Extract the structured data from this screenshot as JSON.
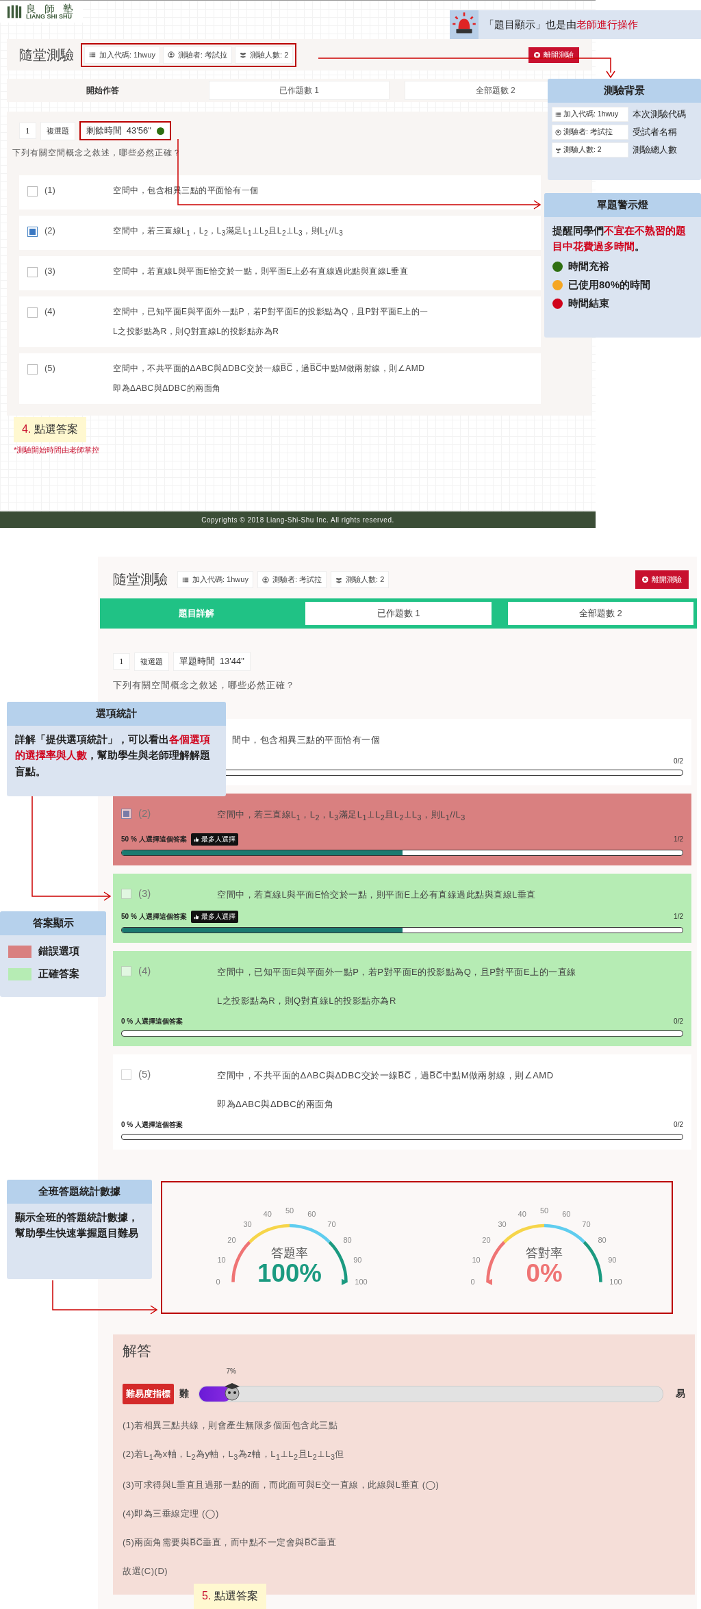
{
  "top_screen": {
    "logo": {
      "name": "良 師 塾",
      "subtitle": "LIANG SHI SHU"
    },
    "header": {
      "title": "隨堂測驗",
      "chips": [
        {
          "kind": "code",
          "text": "加入代碼: 1hwuy"
        },
        {
          "kind": "tester",
          "text": "測驗者: 考試拉"
        },
        {
          "kind": "count",
          "text": "測驗人數: 2"
        }
      ],
      "leave_button": "離開測驗"
    },
    "tabs": [
      {
        "label": "開始作答",
        "selected": true
      },
      {
        "label": "已作題數 1",
        "selected": false
      },
      {
        "label": "全部題數 2",
        "selected": false
      }
    ],
    "question": {
      "number": "1",
      "type": "複選題",
      "timer": {
        "label": "剩餘時間",
        "value": "43'56\"",
        "color": "#2f6f12"
      },
      "prompt": "下列有關空間概念之敘述，哪些必然正確？",
      "options": [
        {
          "label": "(1)",
          "checked": false,
          "lines": [
            "空間中，包含相異三點的平面恰有一個"
          ]
        },
        {
          "label": "(2)",
          "checked": true,
          "lines": [
            "空間中，若三直線L$_{1}$，L$_{2}$，L$_{3}$滿足L$_{1}$⊥L$_{2}$且L$_{2}$⊥L$_{3}$，則L$_{1}$//L$_{3}$"
          ]
        },
        {
          "label": "(3)",
          "checked": false,
          "lines": [
            "空間中，若直線L與平面E恰交於一點，則平面E上必有直線過此點與直線L垂直"
          ]
        },
        {
          "label": "(4)",
          "checked": false,
          "lines": [
            "空間中，已知平面E與平面外一點P，若P對平面E的投影點為Q，且P對平面E上的一",
            "L之投影點為R，則Q對直線L的投影點亦為R"
          ]
        },
        {
          "label": "(5)",
          "checked": false,
          "lines": [
            "空間中，不共平面的ΔABC與ΔDBC交於一線B̅C̅，過B̅C̅中點M做兩射線，則∠AMD",
            "即為ΔABC與ΔDBC的兩面角"
          ]
        }
      ]
    },
    "note": {
      "step": "4.",
      "text": "點選答案"
    },
    "footnote": "*測驗開始時間由老師掌控",
    "footer": "Copyrights © 2018 Liang-Shi-Shu Inc. All rights reserved."
  },
  "top_callouts": {
    "banner": {
      "parts": [
        {
          "text": "「題目顯示」也是由",
          "emphasis": false
        },
        {
          "text": "老師進行操作",
          "emphasis": true
        }
      ]
    },
    "background": {
      "title": "測驗背景",
      "rows": [
        {
          "kind": "code",
          "chip": "加入代碼: 1hwuy",
          "label": "本次測驗代碼"
        },
        {
          "kind": "tester",
          "chip": "測驗者: 考試拉",
          "label": "受試者名稱"
        },
        {
          "kind": "count",
          "chip": "測驗人數: 2",
          "label": "測驗總人數"
        }
      ]
    },
    "warning": {
      "title": "單題警示燈",
      "parts": [
        {
          "text": "提醒同學們",
          "emphasis": false
        },
        {
          "text": "不宜在不熟習的題目中花費過多時間",
          "emphasis": true
        },
        {
          "text": "。",
          "emphasis": false
        }
      ],
      "items": [
        {
          "color": "#2f6f12",
          "label": "時間充裕"
        },
        {
          "color": "#f5a623",
          "label": "已使用80%的時間"
        },
        {
          "color": "#d0021b",
          "label": "時間結束"
        }
      ]
    }
  },
  "bottom_screen": {
    "header": {
      "title": "隨堂測驗",
      "chips": [
        {
          "kind": "code",
          "text": "加入代碼: 1hwuy"
        },
        {
          "kind": "tester",
          "text": "測驗者: 考試拉"
        },
        {
          "kind": "count",
          "text": "測驗人數: 2"
        }
      ],
      "leave_button": "離開測驗"
    },
    "tabs": [
      {
        "label": "題目詳解",
        "selected": true
      },
      {
        "label": "已作題數 1",
        "selected": false
      },
      {
        "label": "全部題數 2",
        "selected": false
      }
    ],
    "question": {
      "number": "1",
      "type": "複選題",
      "timer_label": "單題時間",
      "timer": "13'44\"",
      "prompt": "下列有關空間概念之敘述，哪些必然正確？",
      "options": [
        {
          "kind": "plain",
          "lines": [
            "間中，包含相異三點的平面恰有一個"
          ],
          "count": "0/2",
          "level": 0
        },
        {
          "kind": "wrong",
          "label": "(2)",
          "checked": true,
          "lines": [
            "空間中，若三直線L$_{1}$，L$_{2}$，L$_{3}$滿足L$_{1}$⊥L$_{2}$且L$_{2}$⊥L$_{3}$，則L$_{1}$//L$_{3}$"
          ],
          "share": "50 % 人選擇這個答案",
          "badge": "最多人選擇",
          "count": "1/2",
          "level": 0.5
        },
        {
          "kind": "correct",
          "label": "(3)",
          "checked": false,
          "lines": [
            "空間中，若直線L與平面E恰交於一點，則平面E上必有直線過此點與直線L垂直"
          ],
          "share": "50 % 人選擇這個答案",
          "badge": "最多人選擇",
          "count": "1/2",
          "level": 0.5
        },
        {
          "kind": "correct",
          "label": "(4)",
          "checked": false,
          "lines": [
            "空間中，已知平面E與平面外一點P，若P對平面E的投影點為Q，且P對平面E上的一直線",
            "L之投影點為R，則Q對直線L的投影點亦為R"
          ],
          "share": "0 % 人選擇這個答案",
          "count": "0/2",
          "level": 0
        },
        {
          "kind": "plain",
          "label": "(5)",
          "checked": false,
          "lines": [
            "空間中，不共平面的ΔABC與ΔDBC交於一線B̅C̅，過B̅C̅中點M做兩射線，則∠AMD",
            "即為ΔABC與ΔDBC的兩面角"
          ],
          "share": "0 % 人選擇這個答案",
          "count": "0/2",
          "level": 0
        }
      ]
    },
    "gauges": [
      {
        "title": "答題率",
        "value": "100%",
        "level": 1,
        "ticks": [
          "0",
          "10",
          "20",
          "30",
          "40",
          "50",
          "60",
          "70",
          "80",
          "90",
          "100"
        ]
      },
      {
        "title": "答對率",
        "value": "0%",
        "level": 0,
        "ticks": [
          "0",
          "10",
          "20",
          "30",
          "40",
          "50",
          "60",
          "70",
          "80",
          "90",
          "100"
        ]
      }
    ],
    "solution": {
      "title": "解答",
      "difficulty": {
        "badge": "難易度指標",
        "hard": "難",
        "easy": "易",
        "percent": "7%",
        "level": 0.07
      },
      "lines": [
        "(1)若相異三點共線，則會產生無限多個面包含此三點",
        "(2)若L$_{1}$為x軸，L$_{2}$為y軸，L$_{3}$為z軸，L$_{1}$⊥L$_{2}$且L$_{2}$⊥L$_{3}$但",
        "(3)可求得與L垂直且過那一點的面，而此面可與E交一直線，此線與L垂直 (◯)",
        "(4)即為三垂線定理 (◯)",
        "(5)兩面角需要與B̅C̅垂直，而中點不一定會與B̅C̅垂直",
        "故選(C)(D)"
      ]
    },
    "note": {
      "step": "5.",
      "text": "點選答案"
    }
  },
  "bottom_callouts": {
    "option_stats": {
      "title": "選項統計",
      "parts": [
        {
          "text": "詳解「提供選項統計」，可以看出",
          "emphasis": false
        },
        {
          "text": "各個選項的選擇率與人數",
          "emphasis": true
        },
        {
          "text": "，幫助學生與老師理解解題盲點。",
          "emphasis": false
        }
      ]
    },
    "legend": {
      "title": "答案顯示",
      "items": [
        {
          "color": "#d98080",
          "label": "錯誤選項"
        },
        {
          "color": "#b6ecb4",
          "label": "正確答案"
        }
      ]
    },
    "class_stats": {
      "title": "全班答題統計數據",
      "text": "顯示全班的答題統計數據，幫助學生快速掌握題目難易"
    }
  }
}
